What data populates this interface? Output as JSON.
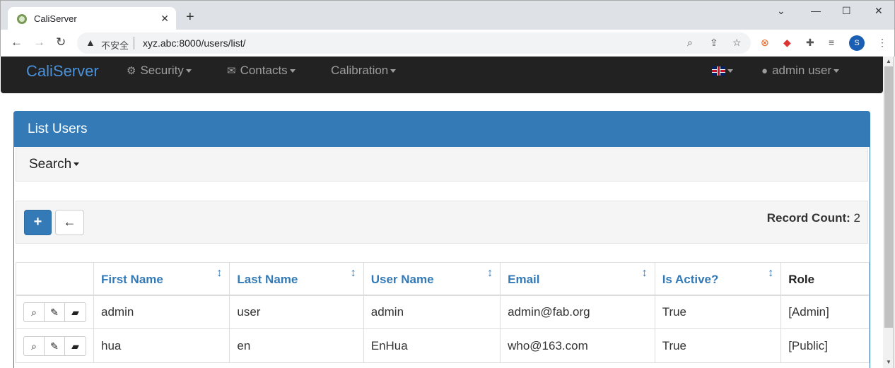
{
  "browser": {
    "tab_title": "CaliServer",
    "insecure_label": "不安全",
    "url": "xyz.abc:8000/users/list/",
    "profile_initial": "S"
  },
  "nav": {
    "brand": "CaliServer",
    "security": "Security",
    "contacts": "Contacts",
    "calibration": "Calibration",
    "user": "admin user"
  },
  "panel": {
    "title": "List Users",
    "search": "Search",
    "record_count_label": "Record Count:",
    "record_count": "2",
    "add_symbol": "+",
    "back_symbol": "←"
  },
  "table": {
    "headers": [
      "First Name",
      "Last Name",
      "User Name",
      "Email",
      "Is Active?",
      "Role"
    ],
    "rows": [
      [
        "admin",
        "user",
        "admin",
        "admin@fab.org",
        "True",
        "[Admin]"
      ],
      [
        "hua",
        "en",
        "EnHua",
        "who@163.com",
        "True",
        "[Public]"
      ]
    ]
  },
  "colors": {
    "primary": "#337ab7",
    "navbar": "#222222"
  }
}
